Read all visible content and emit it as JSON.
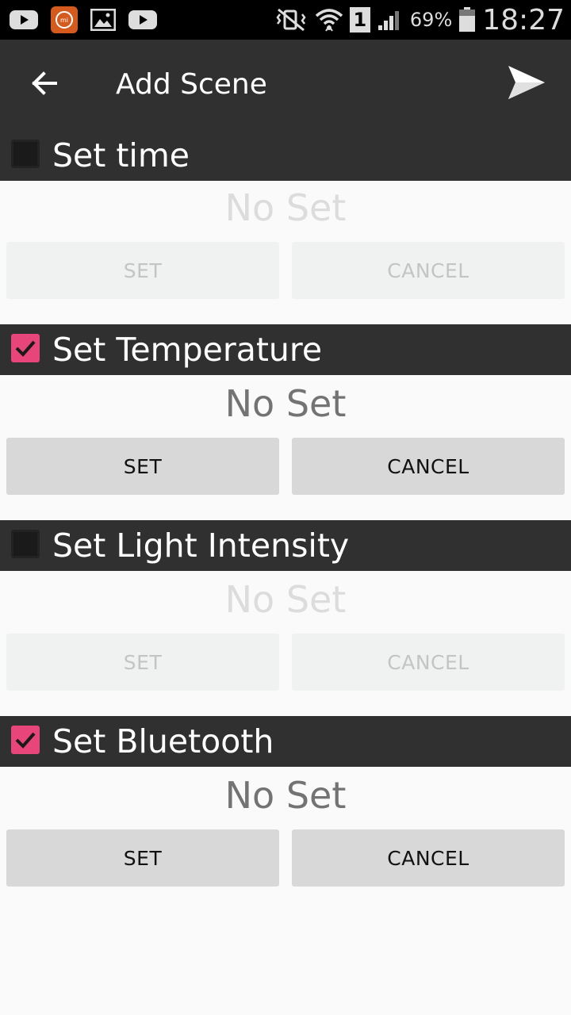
{
  "status_bar": {
    "battery_percent": "69%",
    "clock": "18:27",
    "sim_slot": "1",
    "left_icons": [
      "youtube-icon",
      "mi-app-icon",
      "gallery-icon",
      "youtube-icon"
    ],
    "right_icons": [
      "vibrate-muted-icon",
      "wifi-icon",
      "sim-icon",
      "signal-icon",
      "battery-icon"
    ]
  },
  "toolbar": {
    "title": "Add Scene",
    "back_icon": "arrow-left-icon",
    "send_icon": "send-icon"
  },
  "sections": [
    {
      "label": "Set time",
      "checked": false,
      "value": "No Set",
      "set_label": "SET",
      "cancel_label": "CANCEL"
    },
    {
      "label": "Set Temperature",
      "checked": true,
      "value": "No Set",
      "set_label": "SET",
      "cancel_label": "CANCEL"
    },
    {
      "label": "Set Light Intensity",
      "checked": false,
      "value": "No Set",
      "set_label": "SET",
      "cancel_label": "CANCEL"
    },
    {
      "label": "Set Bluetooth",
      "checked": true,
      "value": "No Set",
      "set_label": "SET",
      "cancel_label": "CANCEL"
    }
  ],
  "colors": {
    "header_bg": "#303030",
    "accent_checkbox": "#e8457a",
    "mi_logo": "#d45a1e"
  }
}
